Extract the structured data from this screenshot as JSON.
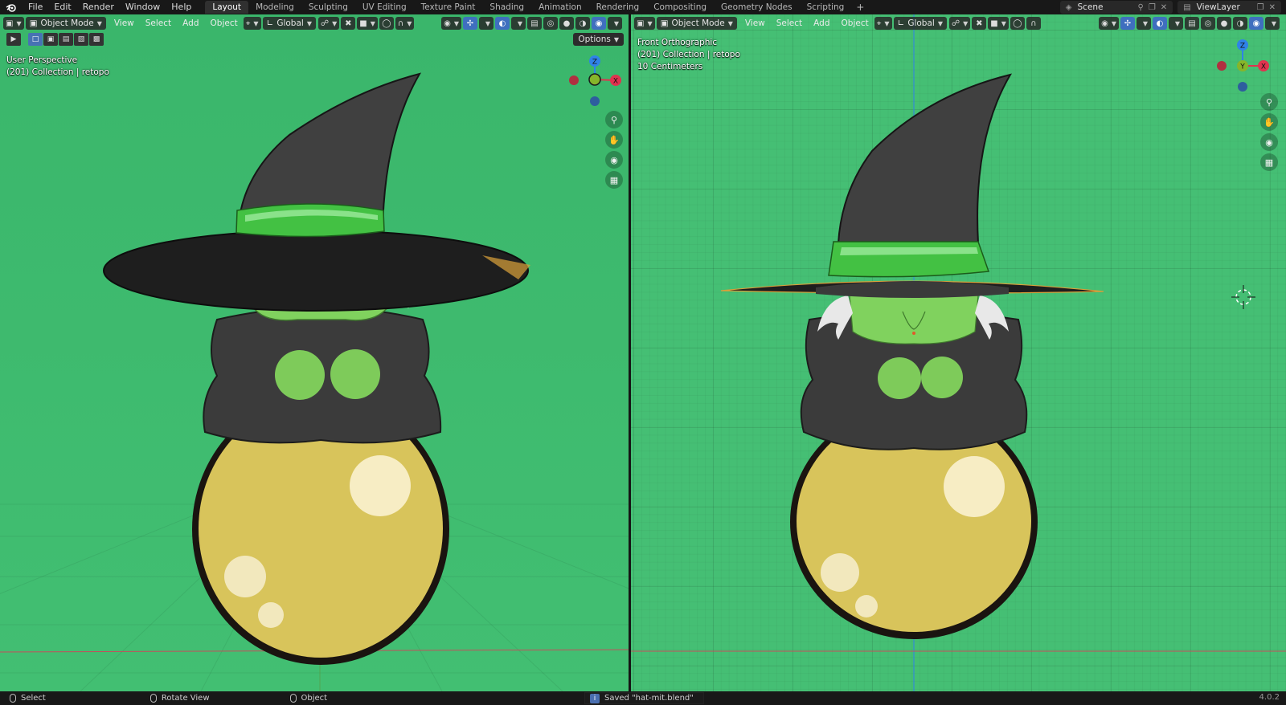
{
  "app": {
    "menu": [
      "File",
      "Edit",
      "Render",
      "Window",
      "Help"
    ],
    "workspaces": [
      "Layout",
      "Modeling",
      "Sculpting",
      "UV Editing",
      "Texture Paint",
      "Shading",
      "Animation",
      "Rendering",
      "Compositing",
      "Geometry Nodes",
      "Scripting"
    ],
    "active_workspace": "Layout",
    "scene_name": "Scene",
    "view_layer_name": "ViewLayer"
  },
  "viewport_left": {
    "mode": "Object Mode",
    "menus": [
      "View",
      "Select",
      "Add",
      "Object"
    ],
    "transform_orientation": "Global",
    "options_label": "Options",
    "view_name": "User Perspective",
    "collection_info": "(201) Collection | retopo",
    "gizmo_axes": [
      "Z",
      "X"
    ]
  },
  "viewport_right": {
    "mode": "Object Mode",
    "menus": [
      "View",
      "Select",
      "Add",
      "Object"
    ],
    "transform_orientation": "Global",
    "view_name": "Front Orthographic",
    "collection_info": "(201) Collection | retopo",
    "scale_info": "10 Centimeters",
    "gizmo_axes": [
      "Z",
      "Y",
      "X"
    ]
  },
  "statusbar": {
    "select_label": "Select",
    "rotate_label": "Rotate View",
    "object_label": "Object",
    "saved_message": "Saved \"hat-mit.blend\"",
    "version": "4.0.2"
  },
  "colors": {
    "viewport_green": "#42bf72",
    "hat_black": "#3d3d3d",
    "hat_band": "#3fc23f",
    "skin_green": "#7fd45e",
    "cauldron_yellow": "#d9c55d",
    "axis_x": "#e0334f",
    "axis_y": "#86b52a",
    "axis_z": "#2f82e8"
  },
  "icons": {
    "blender_logo": "blender-logo-icon",
    "zoom": "zoom-icon",
    "pan": "hand-icon",
    "camera": "camera-icon",
    "grid": "grid-icon"
  }
}
